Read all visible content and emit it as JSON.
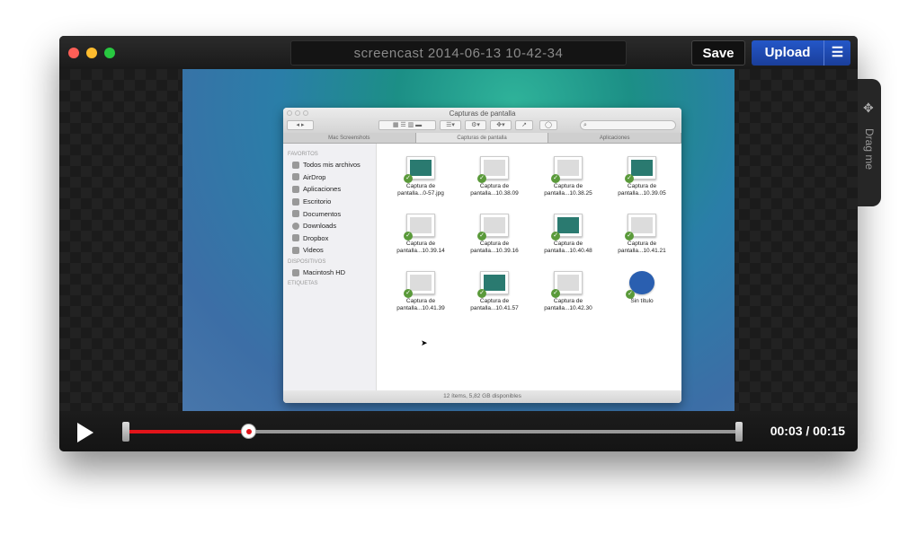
{
  "window": {
    "title": "screencast 2014-06-13 10-42-34",
    "save_label": "Save",
    "upload_label": "Upload"
  },
  "colors": {
    "accent": "#2457c8",
    "progress": "#e2141a",
    "close": "#ff5f57",
    "minimize": "#febc2e",
    "zoom": "#28c840"
  },
  "drag_tab": {
    "label": "Drag me",
    "icon": "move-arrows-icon"
  },
  "player": {
    "current_time": "00:03",
    "duration": "00:15",
    "time_display": "00:03 / 00:15",
    "progress_fraction": 0.2
  },
  "finder": {
    "title": "Capturas de pantalla",
    "tabs": [
      {
        "label": "Mac Screenshots"
      },
      {
        "label": "Capturas de pantalla"
      },
      {
        "label": "Aplicaciones"
      }
    ],
    "sidebar": {
      "favorites_header": "FAVORITOS",
      "favorites": [
        {
          "label": "Todos mis archivos"
        },
        {
          "label": "AirDrop"
        },
        {
          "label": "Aplicaciones"
        },
        {
          "label": "Escritorio"
        },
        {
          "label": "Documentos"
        },
        {
          "label": "Downloads"
        },
        {
          "label": "Dropbox"
        },
        {
          "label": "Videos"
        }
      ],
      "devices_header": "DISPOSITIVOS",
      "devices": [
        {
          "label": "Macintosh HD"
        }
      ],
      "tags_header": "ETIQUETAS"
    },
    "files": [
      {
        "line1": "Captura de",
        "line2": "pantalla...0-57.jpg"
      },
      {
        "line1": "Captura de",
        "line2": "pantalla...10.38.09"
      },
      {
        "line1": "Captura de",
        "line2": "pantalla...10.38.25"
      },
      {
        "line1": "Captura de",
        "line2": "pantalla...10.39.05"
      },
      {
        "line1": "Captura de",
        "line2": "pantalla...10.39.14"
      },
      {
        "line1": "Captura de",
        "line2": "pantalla...10.39.16"
      },
      {
        "line1": "Captura de",
        "line2": "pantalla...10.40.48"
      },
      {
        "line1": "Captura de",
        "line2": "pantalla...10.41.21"
      },
      {
        "line1": "Captura de",
        "line2": "pantalla...10.41.39"
      },
      {
        "line1": "Captura de",
        "line2": "pantalla...10.41.57"
      },
      {
        "line1": "Captura de",
        "line2": "pantalla...10.42.30"
      },
      {
        "line1": "Sin título",
        "line2": ""
      }
    ],
    "status": "12 ítems, 5,82 GB disponibles"
  }
}
